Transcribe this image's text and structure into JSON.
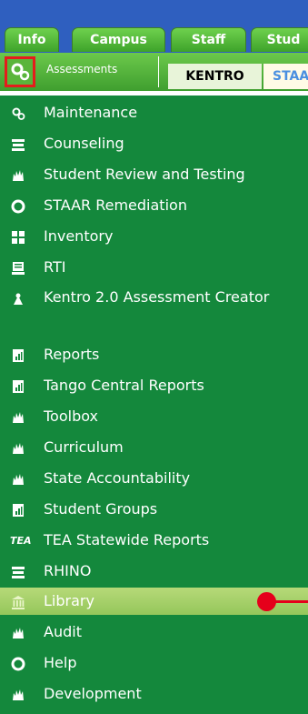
{
  "top_tabs": [
    "Info",
    "Campus",
    "Staff",
    "Stud"
  ],
  "subbar": {
    "module_label": "Assessments",
    "subtabs": [
      "KENTRO",
      "STAA"
    ]
  },
  "menu": [
    {
      "label": "Maintenance",
      "icon": "gears-icon"
    },
    {
      "label": "Counseling",
      "icon": "books-icon"
    },
    {
      "label": "Student Review and Testing",
      "icon": "people-icon"
    },
    {
      "label": "STAAR Remediation",
      "icon": "lifebuoy-icon"
    },
    {
      "label": "Inventory",
      "icon": "boxes-icon"
    },
    {
      "label": "RTI",
      "icon": "rti-icon"
    },
    {
      "label": "Kentro 2.0 Assessment Creator",
      "icon": "tool-icon"
    },
    {
      "label": "Reports",
      "icon": "report-icon"
    },
    {
      "label": "Tango Central Reports",
      "icon": "report-icon"
    },
    {
      "label": "Toolbox",
      "icon": "people-icon"
    },
    {
      "label": "Curriculum",
      "icon": "people-icon"
    },
    {
      "label": "State Accountability",
      "icon": "people-icon"
    },
    {
      "label": "Student Groups",
      "icon": "report-icon"
    },
    {
      "label": "TEA Statewide Reports",
      "icon": "tea-icon",
      "icon_text": "TEA"
    },
    {
      "label": "RHINO",
      "icon": "books-icon"
    },
    {
      "label": "Library",
      "icon": "library-icon",
      "selected": true
    },
    {
      "label": "Audit",
      "icon": "people-icon"
    },
    {
      "label": "Help",
      "icon": "lifebuoy-icon"
    },
    {
      "label": "Development",
      "icon": "people-icon"
    }
  ],
  "colors": {
    "menu_bg": "#14883c",
    "selected_bg": "#a6d06a",
    "highlight": "#e5001b",
    "header_blue": "#2f5fbf"
  }
}
